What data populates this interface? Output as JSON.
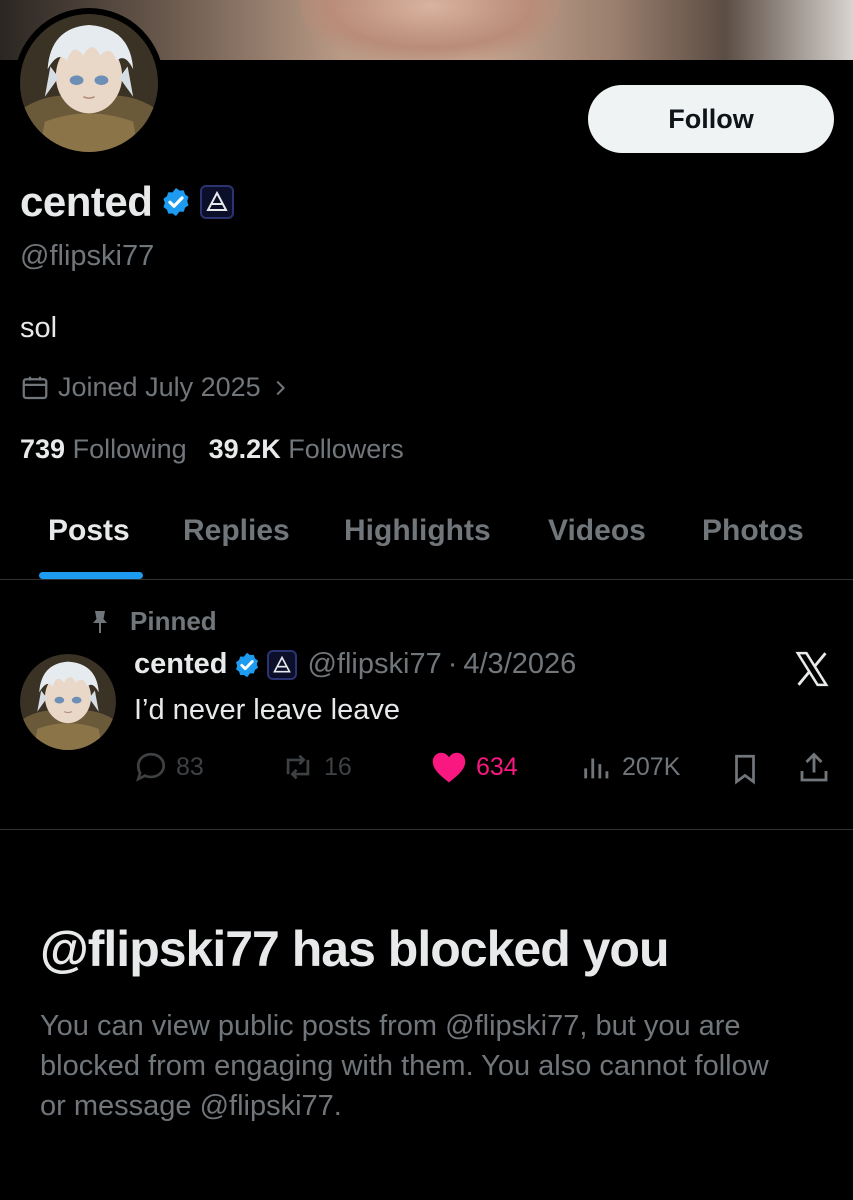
{
  "profile": {
    "display_name": "cented",
    "handle": "@flipski77",
    "bio": "sol",
    "joined": "Joined July 2025",
    "following_count": "739",
    "following_label": "Following",
    "followers_count": "39.2K",
    "followers_label": "Followers",
    "follow_button_label": "Follow",
    "verified_icon": "verified-badge-icon",
    "affiliate_icon": "affiliate-badge-icon"
  },
  "tabs": [
    {
      "label": "Posts",
      "active": true
    },
    {
      "label": "Replies"
    },
    {
      "label": "Highlights"
    },
    {
      "label": "Videos"
    },
    {
      "label": "Photos"
    }
  ],
  "pinned_post": {
    "pinned_label": "Pinned",
    "author_name": "cented",
    "author_handle": "@flipski77",
    "separator": "·",
    "date": "4/3/2026",
    "text": "I’d never leave leave",
    "replies": "83",
    "reposts": "16",
    "likes": "634",
    "views": "207K"
  },
  "blocked_notice": {
    "title": "@flipski77 has blocked you",
    "message": "You can view public posts from @flipski77, but you are blocked from engaging with them. You also cannot follow or message @flipski77."
  },
  "colors": {
    "background": "#000000",
    "text_primary": "#e7e9ea",
    "text_secondary": "#71767b",
    "accent_blue": "#1d9bf0",
    "like_pink": "#f91880",
    "follow_button_bg": "#eff3f4"
  }
}
